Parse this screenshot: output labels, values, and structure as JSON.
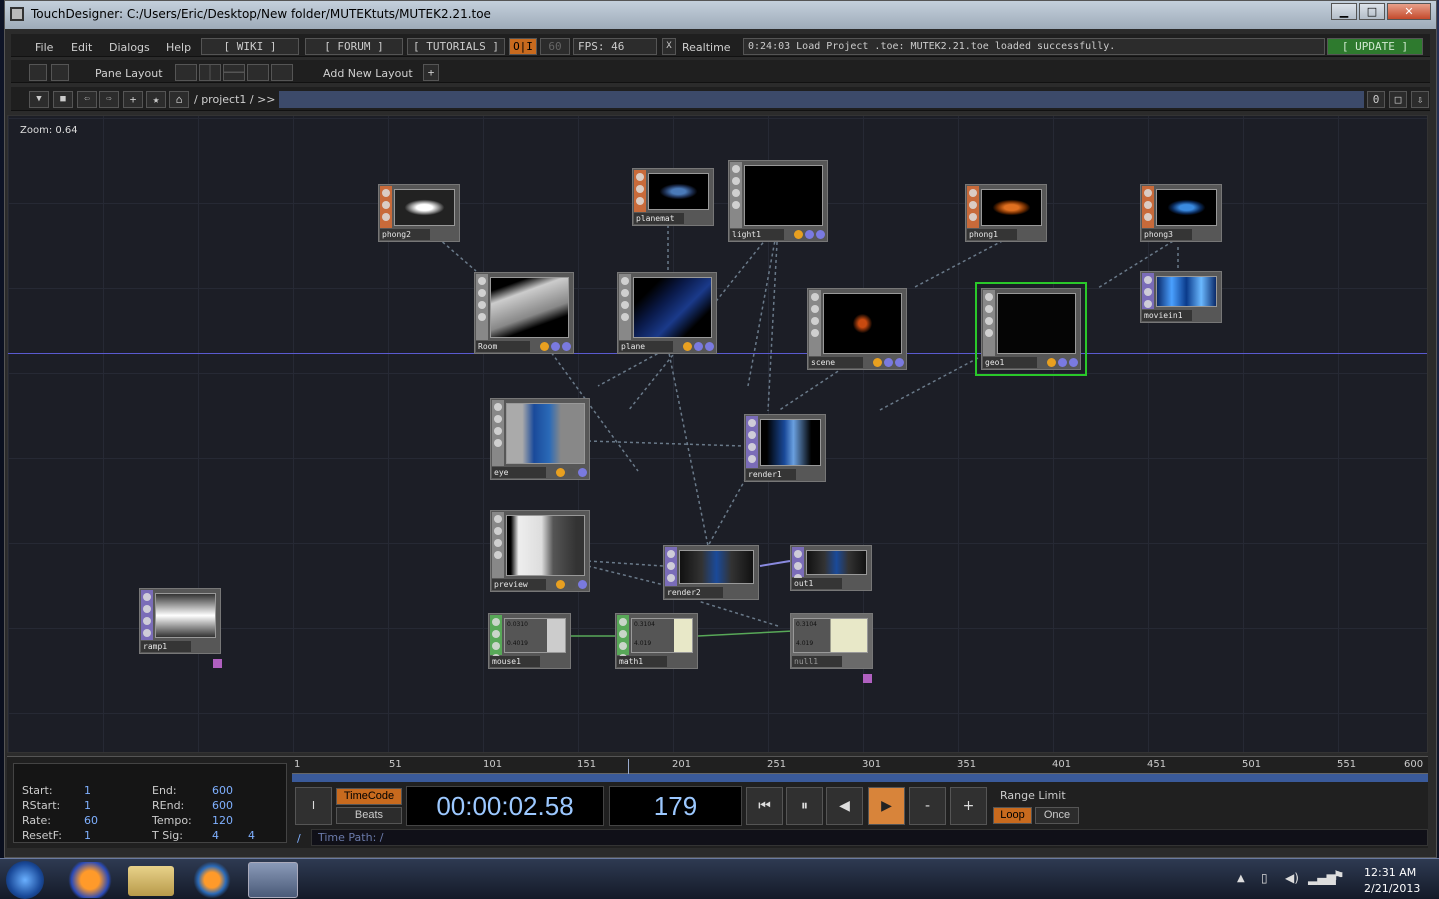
{
  "window": {
    "title": "TouchDesigner: C:/Users/Eric/Desktop/New folder/MUTEKtuts/MUTEK2.21.toe",
    "min": "▁",
    "max": "□",
    "close": "✕"
  },
  "menubar": {
    "file": "File",
    "edit": "Edit",
    "dialogs": "Dialogs",
    "help": "Help",
    "wiki": "[ WIKI ]",
    "forum": "[ FORUM ]",
    "tutorials": "[ TUTORIALS ]",
    "oi": "O|I",
    "fps_target": "60",
    "fps_label": "FPS:",
    "fps_value": "46",
    "realtime_check": "X",
    "realtime": "Realtime",
    "status": "0:24:03 Load Project .toe: MUTEK2.21.toe loaded successfully.",
    "update": "[ UPDATE ]"
  },
  "panebar": {
    "pane_layout": "Pane Layout",
    "add_layout": "Add New Layout",
    "plus": "+"
  },
  "pathbar": {
    "path": "/ project1 / >>",
    "zero": "0"
  },
  "network": {
    "zoom": "Zoom: 0.64",
    "ops": [
      {
        "name": "phong2"
      },
      {
        "name": "planemat"
      },
      {
        "name": "light1"
      },
      {
        "name": "phong1"
      },
      {
        "name": "phong3"
      },
      {
        "name": "Room"
      },
      {
        "name": "plane"
      },
      {
        "name": "scene"
      },
      {
        "name": "geo1"
      },
      {
        "name": "moviein1"
      },
      {
        "name": "eye"
      },
      {
        "name": "render1"
      },
      {
        "name": "preview"
      },
      {
        "name": "render2"
      },
      {
        "name": "out1"
      },
      {
        "name": "ramp1"
      },
      {
        "name": "mouse1"
      },
      {
        "name": "math1"
      },
      {
        "name": "null1"
      }
    ],
    "chop_values": {
      "mouse1": [
        "0.0310",
        "0.4019",
        "tx",
        "ty"
      ],
      "math1": [
        "0.3104",
        "4.019",
        "tx",
        "ty"
      ],
      "null1": [
        "0.3104",
        "4.019",
        "tx",
        "ty"
      ]
    }
  },
  "timeline": {
    "ruler": [
      "1",
      "51",
      "101",
      "151",
      "201",
      "251",
      "301",
      "351",
      "401",
      "451",
      "501",
      "551",
      "600"
    ],
    "start_label": "Start:",
    "start": "1",
    "end_label": "End:",
    "end": "600",
    "rstart_label": "RStart:",
    "rstart": "1",
    "rend_label": "REnd:",
    "rend": "600",
    "rate_label": "Rate:",
    "rate": "60",
    "tempo_label": "Tempo:",
    "tempo": "120",
    "resetf_label": "ResetF:",
    "resetf": "1",
    "tsig_label": "T Sig:",
    "tsig1": "4",
    "tsig2": "4",
    "timecode_btn": "TimeCode",
    "beats_btn": "Beats",
    "timecode": "00:00:02.58",
    "frame": "179",
    "range_limit": "Range Limit",
    "loop": "Loop",
    "once": "Once",
    "timepath_label": "Time Path: /",
    "slash": "/",
    "minus": "-",
    "plus": "+",
    "i_btn": "I"
  },
  "taskbar": {
    "time": "12:31 AM",
    "date": "2/21/2013"
  }
}
